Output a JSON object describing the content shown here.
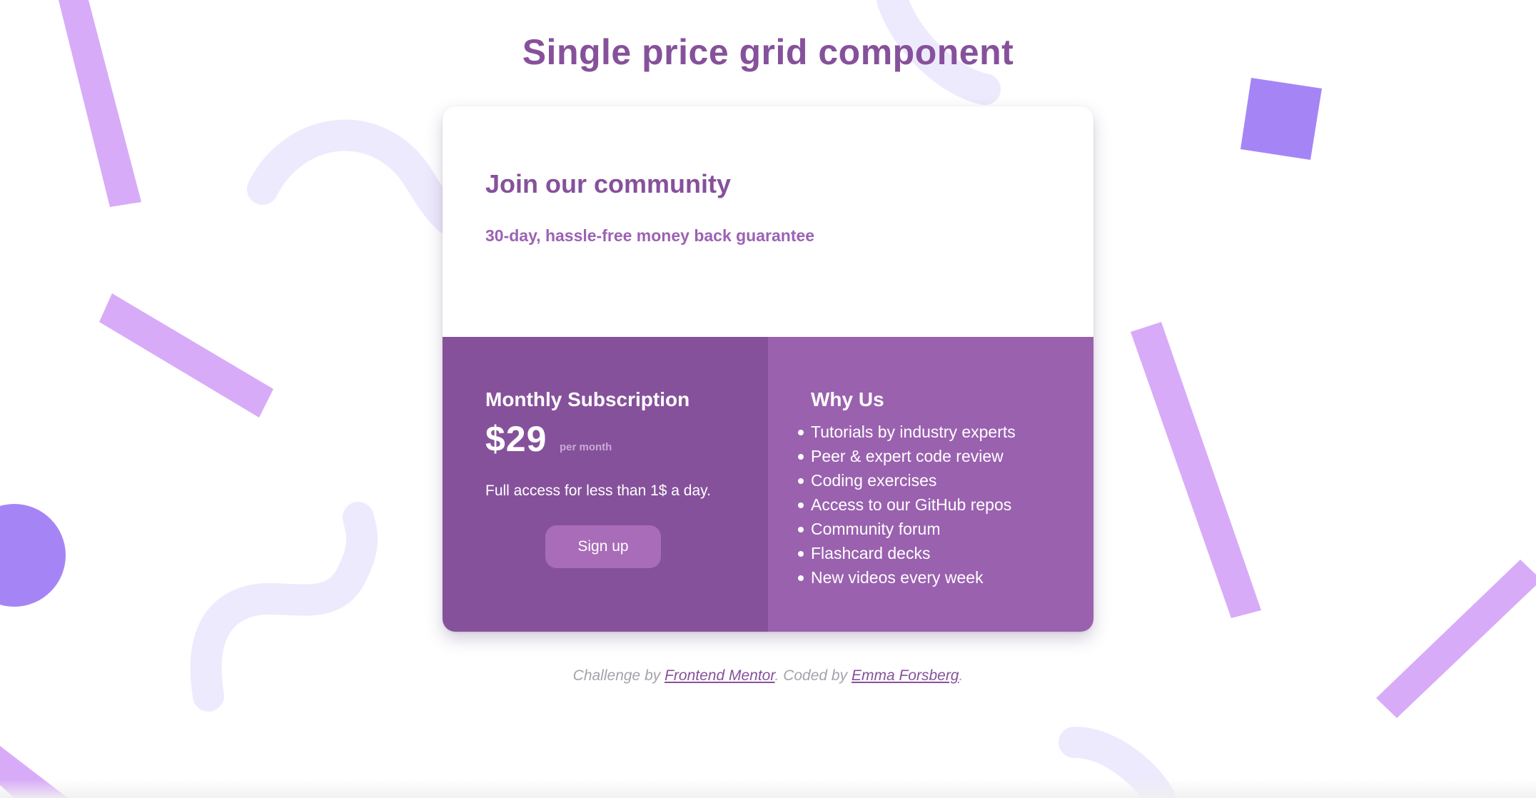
{
  "page": {
    "title": "Single price grid component"
  },
  "card": {
    "heading": "Join our community",
    "guarantee": "30-day, hassle-free money back guarantee",
    "subscription": {
      "title": "Monthly Subscription",
      "price": "$29",
      "period": "per month",
      "description": "Full access for less than 1$ a day.",
      "button_label": "Sign up"
    },
    "why_us": {
      "title": "Why Us",
      "items": [
        "Tutorials by industry experts",
        "Peer & expert code review",
        "Coding exercises",
        "Access to our GitHub repos",
        "Community forum",
        "Flashcard decks",
        "New videos every week"
      ]
    }
  },
  "attribution": {
    "prefix": "Challenge by ",
    "link1": "Frontend Mentor",
    "middle": ". Coded by ",
    "link2": "Emma Forsberg",
    "suffix": "."
  },
  "colors": {
    "primary": "#86519b",
    "secondary": "#9a61af",
    "button": "#a96cb8",
    "confetti_light": "#d8abf8",
    "confetti_dark": "#a585f6",
    "squiggle": "#eeeafd",
    "muted_text": "#a6a1aa"
  }
}
